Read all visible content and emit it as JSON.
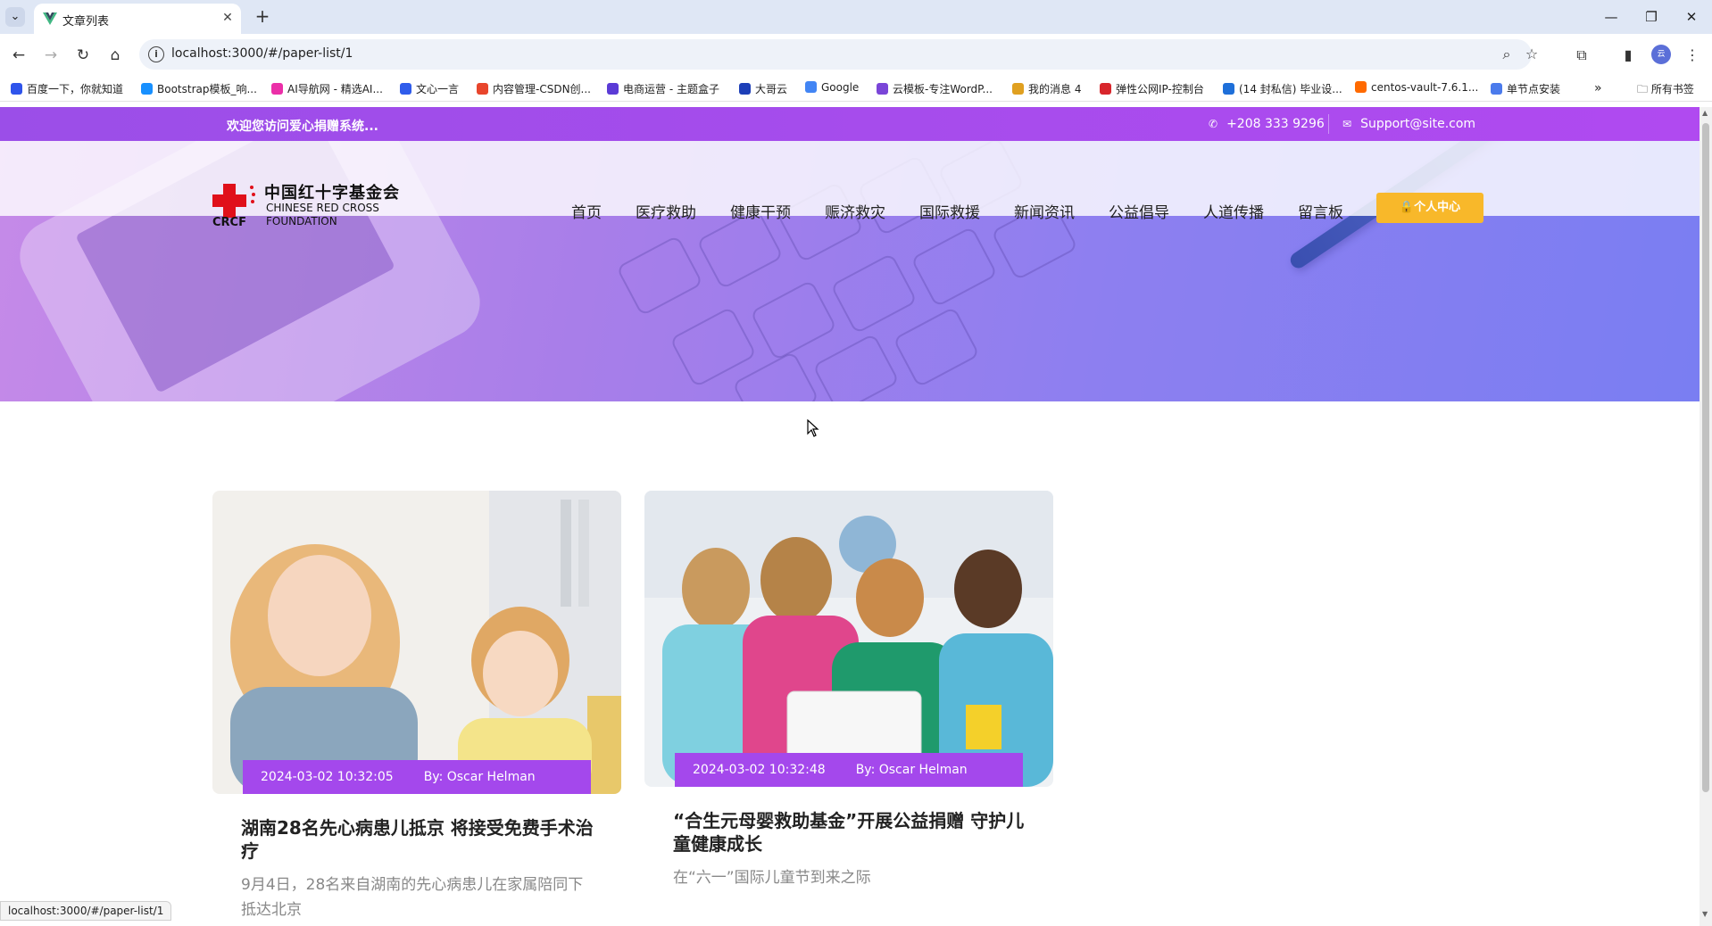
{
  "browser": {
    "tab_title": "文章列表",
    "url": "localhost:3000/#/paper-list/1",
    "status_url": "localhost:3000/#/paper-list/1",
    "profile_label": "云"
  },
  "bookmarks": [
    {
      "label": "百度一下，你就知道",
      "color": "#2f54eb"
    },
    {
      "label": "Bootstrap模板_响...",
      "color": "#1890ff"
    },
    {
      "label": "AI导航网 - 精选AI...",
      "color": "#eb2fa8"
    },
    {
      "label": "文心一言",
      "color": "#2f5ceb"
    },
    {
      "label": "内容管理-CSDN创...",
      "color": "#e8452c"
    },
    {
      "label": "电商运营 - 主题盒子",
      "color": "#5b3bd6"
    },
    {
      "label": "大哥云",
      "color": "#1d3fb8"
    },
    {
      "label": "Google",
      "color": "#4285f4"
    },
    {
      "label": "云模板-专注WordP...",
      "color": "#7a45d8"
    },
    {
      "label": "我的消息 4",
      "color": "#e0a020"
    },
    {
      "label": "弹性公网IP-控制台",
      "color": "#d8262c"
    },
    {
      "label": "(14 封私信) 毕业设...",
      "color": "#1e6fd9"
    },
    {
      "label": "centos-vault-7.6.1...",
      "color": "#ff6a00"
    },
    {
      "label": "单节点安装",
      "color": "#4b7bec"
    }
  ],
  "bookmarks_all": "所有书签",
  "site": {
    "welcome": "欢迎您访问爱心捐赠系统...",
    "phone": "+208 333 9296",
    "email": "Support@site.com",
    "logo": {
      "cn": "中国红十字基金会",
      "en_line1": "CHINESE RED CROSS",
      "en_line2": "FOUNDATION",
      "abbr": "CRCF"
    },
    "nav": [
      "首页",
      "医疗救助",
      "健康干预",
      "赈济救灾",
      "国际救援",
      "新闻资讯",
      "公益倡导",
      "人道传播",
      "留言板"
    ],
    "user_center": "个人中心"
  },
  "articles": [
    {
      "date": "2024-03-02 10:32:05",
      "author": "By: Oscar Helman",
      "title": "湖南28名先心病患儿抵京 将接受免费手术治疗",
      "desc": "9月4日，28名来自湖南的先心病患儿在家属陪同下抵达北京"
    },
    {
      "date": "2024-03-02 10:32:48",
      "author": "By: Oscar Helman",
      "title": "“合生元母婴救助基金”开展公益捐赠 守护儿童健康成长",
      "desc": "在“六一”国际儿童节到来之际"
    }
  ],
  "colors": {
    "accent_purple": "#a448ec",
    "button_yellow": "#f8b82a"
  }
}
